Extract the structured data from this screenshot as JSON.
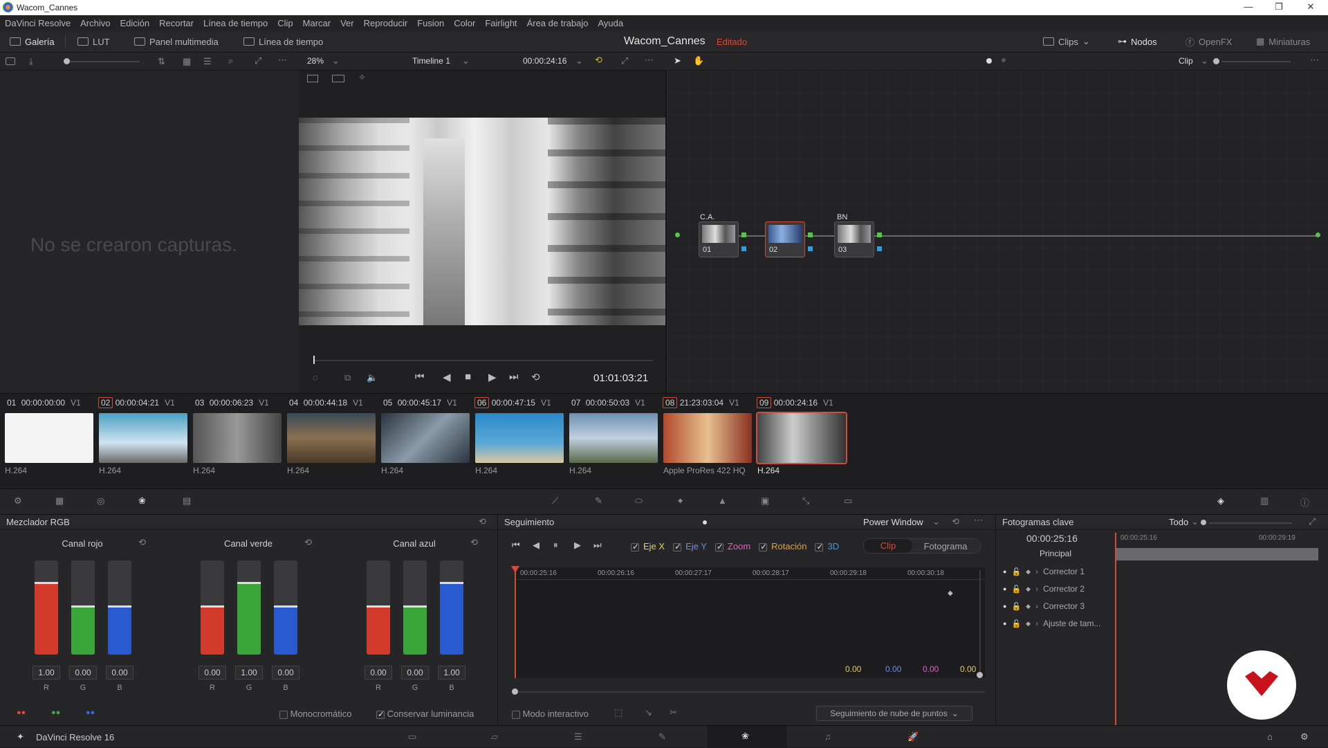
{
  "window": {
    "title": "Wacom_Cannes",
    "minimize": "—",
    "restore": "❐",
    "close": "✕"
  },
  "menu": [
    "DaVinci Resolve",
    "Archivo",
    "Edición",
    "Recortar",
    "Línea de tiempo",
    "Clip",
    "Marcar",
    "Ver",
    "Reproducir",
    "Fusion",
    "Color",
    "Fairlight",
    "Área de trabajo",
    "Ayuda"
  ],
  "toolbar": {
    "gallery": "Galería",
    "lut": "LUT",
    "media": "Panel multimedia",
    "timeline": "Línea de tiempo",
    "project": "Wacom_Cannes",
    "edited": "Editado",
    "clips": "Clips",
    "nodes": "Nodos",
    "openfx": "OpenFX",
    "thumbnails": "Miniaturas"
  },
  "viewer": {
    "zoom": "28%",
    "timeline_name": "Timeline 1",
    "timecode": "00:00:24:16",
    "clip_mode": "Clip",
    "playhead_timecode": "01:01:03:21"
  },
  "gallery": {
    "empty_message": "No se crearon capturas."
  },
  "nodes": [
    {
      "label": "C.A.",
      "num": "01"
    },
    {
      "label": "",
      "num": "02"
    },
    {
      "label": "BN",
      "num": "03"
    }
  ],
  "clips": [
    {
      "num": "01",
      "tc": "00:00:00:00",
      "track": "V1",
      "codec": "H.264",
      "color": "#f4f4f4"
    },
    {
      "num": "02",
      "tc": "00:00:04:21",
      "track": "V1",
      "codec": "H.264",
      "color": "#4a9fc4"
    },
    {
      "num": "03",
      "tc": "00:00:06:23",
      "track": "V1",
      "codec": "H.264",
      "color": "#777"
    },
    {
      "num": "04",
      "tc": "00:00:44:18",
      "track": "V1",
      "codec": "H.264",
      "color": "#6a5a40"
    },
    {
      "num": "05",
      "tc": "00:00:45:17",
      "track": "V1",
      "codec": "H.264",
      "color": "#3d4a55"
    },
    {
      "num": "06",
      "tc": "00:00:47:15",
      "track": "V1",
      "codec": "H.264",
      "color": "#2a88c8"
    },
    {
      "num": "07",
      "tc": "00:00:50:03",
      "track": "V1",
      "codec": "H.264",
      "color": "#6d8fb0"
    },
    {
      "num": "08",
      "tc": "21:23:03:04",
      "track": "V1",
      "codec": "Apple ProRes 422 HQ",
      "color": "#b24a2c"
    },
    {
      "num": "09",
      "tc": "00:00:24:16",
      "track": "V1",
      "codec": "H.264",
      "color": "#888"
    }
  ],
  "rgb_mixer": {
    "title": "Mezclador RGB",
    "channels": [
      {
        "name": "Canal rojo",
        "values": [
          "1.00",
          "0.00",
          "0.00"
        ],
        "levels": [
          0.75,
          0.5,
          0.5
        ]
      },
      {
        "name": "Canal verde",
        "values": [
          "0.00",
          "1.00",
          "0.00"
        ],
        "levels": [
          0.5,
          0.75,
          0.5
        ]
      },
      {
        "name": "Canal azul",
        "values": [
          "0.00",
          "0.00",
          "1.00"
        ],
        "levels": [
          0.5,
          0.5,
          0.75
        ]
      }
    ],
    "rgb_labels": [
      "R",
      "G",
      "B"
    ],
    "monochrome": "Monocromático",
    "preserve_luminance": "Conservar luminancia"
  },
  "tracking": {
    "title": "Seguimiento",
    "mode": "Power Window",
    "axes": [
      "Eje X",
      "Eje Y",
      "Zoom",
      "Rotación",
      "3D"
    ],
    "axis_colors": [
      "#e0d060",
      "#6a8fe8",
      "#e060c8",
      "#e6a030",
      "#3a9ae0"
    ],
    "seg_clip": "Clip",
    "seg_frame": "Fotograma",
    "ruler": [
      "00:00:25:16",
      "00:00:26:16",
      "00:00:27:17",
      "00:00:28:17",
      "00:00:29:18",
      "00:00:30:18"
    ],
    "readouts": [
      "0.00",
      "0.00",
      "0.00",
      "0.00"
    ],
    "interactive": "Modo interactivo",
    "method": "Seguimiento de nube de puntos"
  },
  "keyframes": {
    "title": "Fotogramas clave",
    "filter": "Todo",
    "timecode": "00:00:25:16",
    "ruler": [
      "00:00:25:16",
      "00:00:29:19"
    ],
    "principal": "Principal",
    "rows": [
      "Corrector 1",
      "Corrector 2",
      "Corrector 3",
      "Ajuste de tam..."
    ]
  },
  "status": {
    "app": "DaVinci Resolve 16"
  }
}
